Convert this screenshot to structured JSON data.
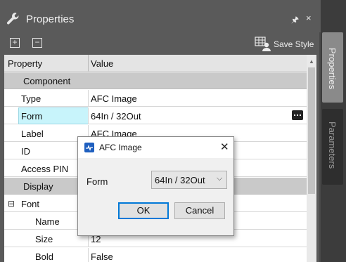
{
  "panel": {
    "title": "Properties",
    "pin_glyph": "🖈",
    "close_glyph": "×"
  },
  "toolbar": {
    "expand_label": "+",
    "collapse_label": "−",
    "save_style_label": "Save Style"
  },
  "grid": {
    "headers": {
      "property": "Property",
      "value": "Value"
    },
    "rows": [
      {
        "label": "Component",
        "value": "",
        "kind": "category"
      },
      {
        "label": "Type",
        "value": "AFC Image",
        "kind": "item"
      },
      {
        "label": "Form",
        "value": "64In / 32Out",
        "kind": "item",
        "selected": true
      },
      {
        "label": "Label",
        "value": "AFC Image",
        "kind": "item"
      },
      {
        "label": "ID",
        "value": "",
        "kind": "item"
      },
      {
        "label": "Access PIN",
        "value": "",
        "kind": "item"
      },
      {
        "label": "Display",
        "value": "",
        "kind": "category"
      },
      {
        "label": "Font",
        "value": "",
        "kind": "subcategory",
        "expander": "⊟"
      },
      {
        "label": "Name",
        "value": "",
        "kind": "subitem"
      },
      {
        "label": "Size",
        "value": "12",
        "kind": "subitem"
      },
      {
        "label": "Bold",
        "value": "False",
        "kind": "subitem"
      }
    ]
  },
  "side_tabs": {
    "properties": "Properties",
    "parameters": "Parameters"
  },
  "dialog": {
    "title": "AFC Image",
    "close_glyph": "✕",
    "form_label": "Form",
    "form_value": "64In / 32Out",
    "ok_label": "OK",
    "cancel_label": "Cancel"
  },
  "colors": {
    "selected_label_bg": "#c8f4fb",
    "category_bg": "#c9c9c9",
    "default_button_border": "#0078d7"
  }
}
